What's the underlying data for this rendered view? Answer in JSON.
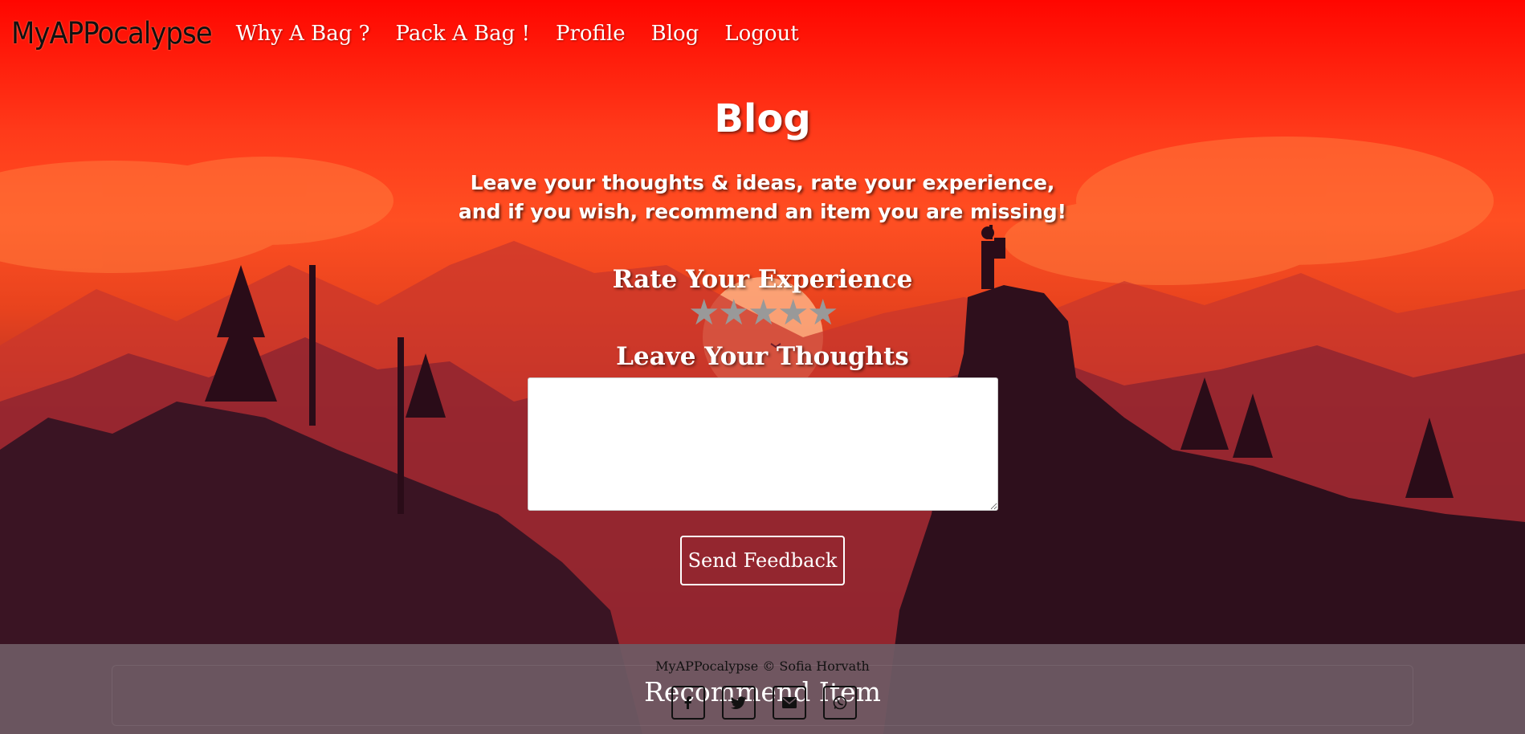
{
  "navbar": {
    "brand": "MyAPPocalypse",
    "links": [
      "Why A Bag ?",
      "Pack A Bag !",
      "Profile",
      "Blog",
      "Logout"
    ]
  },
  "main": {
    "title": "Blog",
    "intro_line1": "Leave your thoughts & ideas, rate your experience,",
    "intro_line2": "and if you wish, recommend an item you are missing!",
    "rate_heading": "Rate Your Experience",
    "stars": [
      "★",
      "★",
      "★",
      "★",
      "★"
    ],
    "rating": 0,
    "thoughts_heading": "Leave Your Thoughts",
    "thoughts_value": "",
    "send_label": "Send Feedback"
  },
  "footer": {
    "copyright": "MyAPPocalypse © Sofia Horvath",
    "recommend_label": "Recommend Item",
    "socials": [
      "facebook-icon",
      "twitter-icon",
      "mail-icon",
      "whatsapp-icon"
    ]
  },
  "colors": {
    "nav_top": "#ff0600",
    "sky": "#ff4f22",
    "star_inactive": "#999999",
    "footer_bg": "#6e5a64"
  }
}
